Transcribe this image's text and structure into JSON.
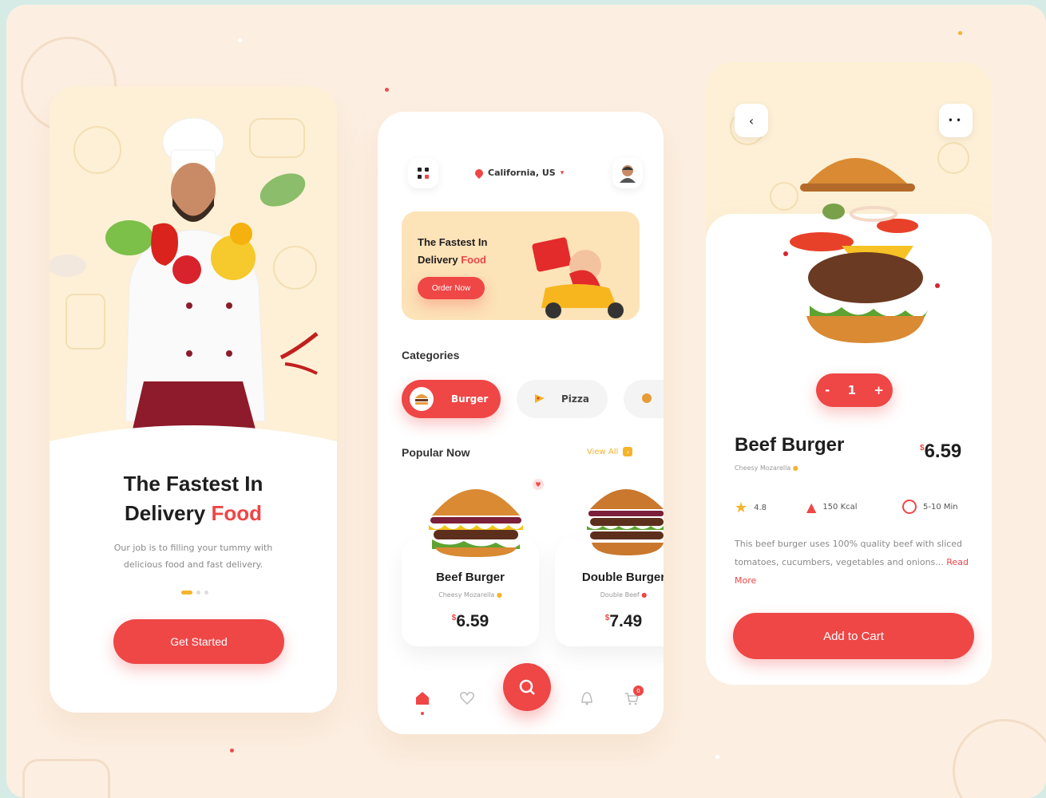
{
  "onboarding": {
    "title_line1": "The Fastest In",
    "title_plain": "Delivery",
    "title_accent": "Food",
    "subtitle": "Our job is to filling your tummy with delicious food and fast delivery.",
    "cta": "Get Started"
  },
  "home": {
    "location": "California, US",
    "banner": {
      "line1": "The Fastest In",
      "line2_plain": "Delivery",
      "line2_accent": "Food",
      "button": "Order Now"
    },
    "categories_title": "Categories",
    "categories": [
      {
        "label": "Burger",
        "icon": "burger-icon",
        "active": true
      },
      {
        "label": "Pizza",
        "icon": "pizza-icon",
        "active": false
      },
      {
        "label": "",
        "icon": "food-icon",
        "active": false
      }
    ],
    "popular_title": "Popular Now",
    "view_all": "View All",
    "items": [
      {
        "name": "Beef Burger",
        "sub": "Cheesy Mozarella",
        "currency": "$",
        "price": "6.59"
      },
      {
        "name": "Double Burger",
        "sub": "Double Beef",
        "currency": "$",
        "price": "7.49"
      }
    ],
    "cart_count": "0"
  },
  "detail": {
    "quantity": "1",
    "minus": "-",
    "plus": "+",
    "name": "Beef Burger",
    "sub": "Cheesy Mozarella",
    "currency": "$",
    "price": "6.59",
    "rating": "4.8",
    "calories": "150 Kcal",
    "time": "5-10 Min",
    "description": "This beef burger uses 100% quality beef with sliced tomatoes, cucumbers, vegetables and onions...",
    "read_more": "Read More",
    "add_to_cart": "Add to Cart"
  },
  "colors": {
    "accent": "#ef4646",
    "yellow": "#f4b42b",
    "background": "#fcefe2"
  }
}
